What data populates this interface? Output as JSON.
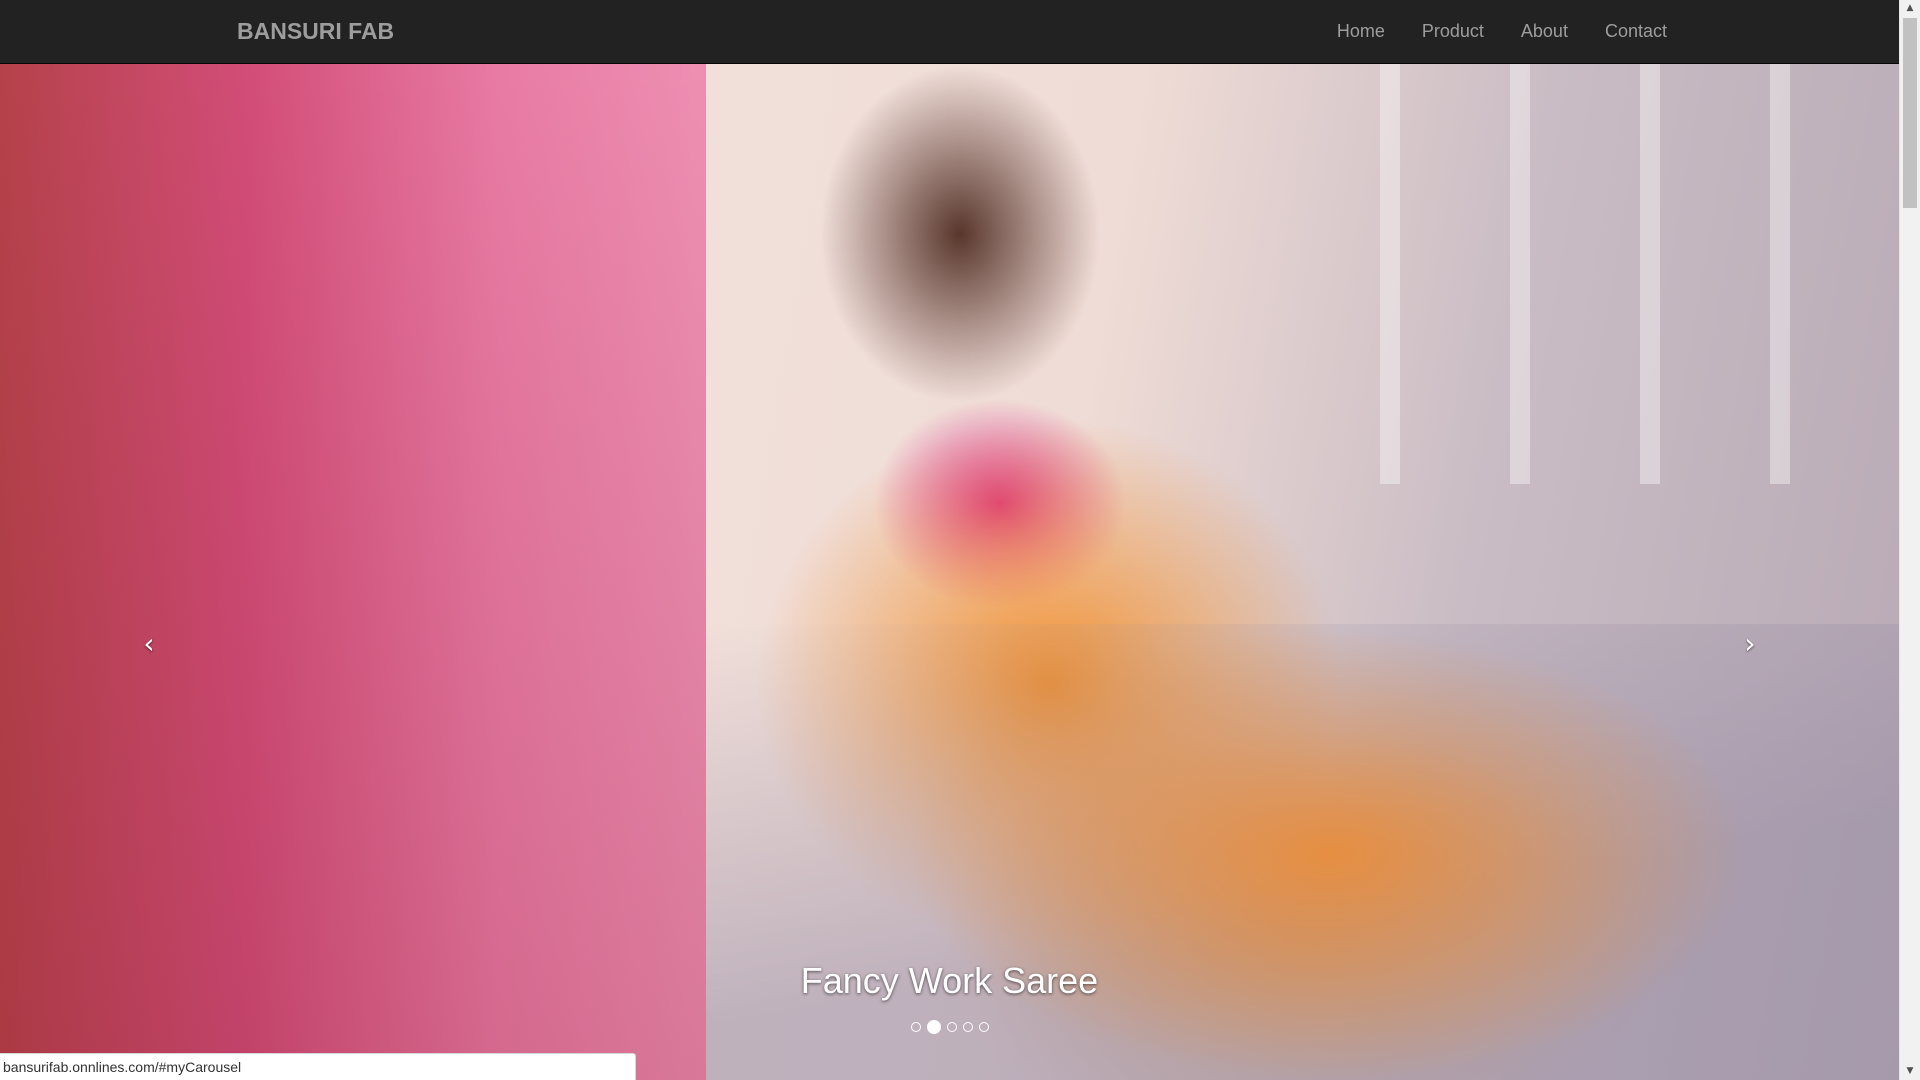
{
  "navbar": {
    "brand": "BANSURI FAB",
    "links": [
      {
        "label": "Home"
      },
      {
        "label": "Product"
      },
      {
        "label": "About"
      },
      {
        "label": "Contact"
      }
    ]
  },
  "carousel": {
    "caption": "Fancy Work Saree",
    "prev_icon": "chevron-left-icon",
    "next_icon": "chevron-right-icon",
    "prev_glyph": "‹",
    "next_glyph": "›",
    "indicators_count": 5,
    "active_index": 1
  },
  "statusbar": {
    "url": "bansurifab.onnlines.com/#myCarousel"
  },
  "colors": {
    "navbar_bg": "#222222",
    "nav_text": "#9d9d9d",
    "caption_text": "#ffffff"
  }
}
